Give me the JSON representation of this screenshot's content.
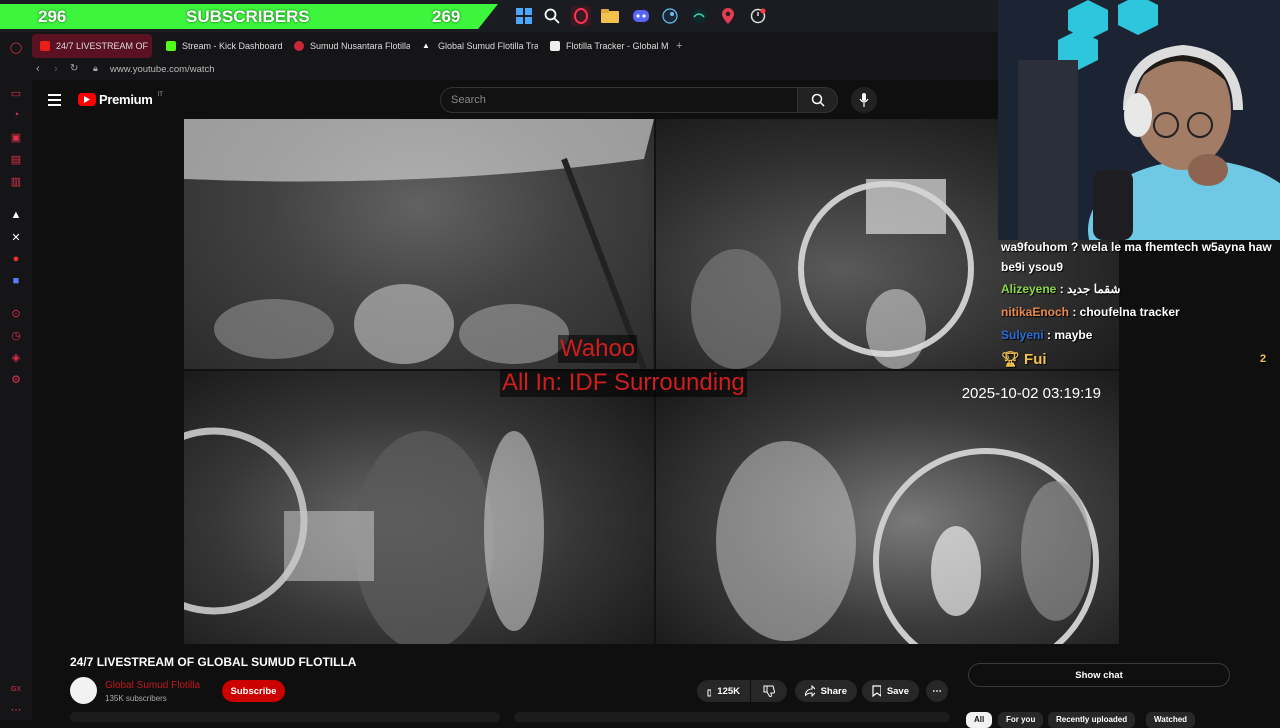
{
  "overlay": {
    "left_count": "296",
    "label": "SUBSCRIBERS",
    "right_count": "269"
  },
  "taskbar_icons": [
    "windows-icon",
    "search-icon",
    "opera-gx-icon",
    "folder-icon",
    "discord-icon",
    "steam-icon",
    "app-icon",
    "maps-pin-icon",
    "clock-icon"
  ],
  "tabs": [
    {
      "label": "24/7 LIVESTREAM OF",
      "active": true
    },
    {
      "label": "Stream - Kick Dashboard",
      "active": false
    },
    {
      "label": "Sumud Nusantara Flotilla",
      "active": false
    },
    {
      "label": "Global Sumud Flotilla Tra",
      "active": false
    },
    {
      "label": "Flotilla Tracker - Global M",
      "active": false
    }
  ],
  "new_tab_label": "+",
  "address": {
    "url": "www.youtube.com/watch"
  },
  "youtube": {
    "brand": "Premium",
    "country_code": "IT",
    "search_placeholder": "Search"
  },
  "video": {
    "overlay_line1": "Wahoo",
    "overlay_line2": "All In: IDF Surrounding",
    "timestamp": "2025-10-02 03:19:19"
  },
  "chat": [
    {
      "user": "",
      "text": "wa9fouhom ? wela le ma fhemtech w5ayna haw",
      "color": "#ffffff"
    },
    {
      "user": "",
      "text": "be9i ysou9",
      "color": "#ffffff"
    },
    {
      "user": "Alizeyene",
      "text": " : شقما جديد",
      "color": "#8bd64a"
    },
    {
      "user": "nitikaEnoch",
      "text": " : choufelna tracker",
      "color": "#e8884a"
    },
    {
      "user": "Sulyeni",
      "text": " : maybe",
      "color": "#2a6cd8"
    }
  ],
  "chat_top_user": {
    "name": "Fui",
    "badge": "2"
  },
  "below": {
    "title": "24/7 LIVESTREAM OF GLOBAL SUMUD FLOTILLA",
    "channel": "Global Sumud Flotilla",
    "subscribers": "135K subscribers",
    "subscribe": "Subscribe",
    "likes": "125K",
    "share": "Share",
    "save": "Save",
    "show_chat": "Show chat"
  },
  "filters": [
    "All",
    "For you",
    "Recently uploaded",
    "Watched"
  ],
  "colors": {
    "accent": "#3cf53c",
    "yt_red": "#cc0000",
    "opera_red": "#e0304a"
  }
}
